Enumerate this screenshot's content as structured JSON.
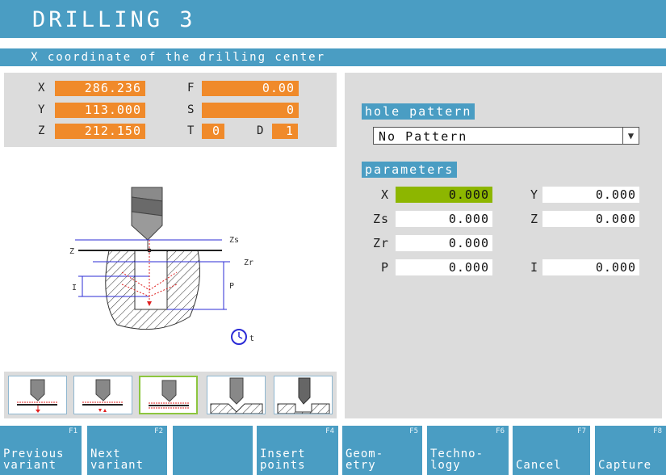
{
  "title": "DRILLING 3",
  "status_text": "X coordinate of the drilling center",
  "coords": {
    "x_label": "X",
    "x_value": "286.236",
    "y_label": "Y",
    "y_value": "113.000",
    "z_label": "Z",
    "z_value": "212.150",
    "f_label": "F",
    "f_value": "0.00",
    "s_label": "S",
    "s_value": "0",
    "t_label": "T",
    "t_value": "0",
    "d_label": "D",
    "d_value": "1"
  },
  "diagram": {
    "zs": "Zs",
    "z": "Z",
    "zr": "Zr",
    "p": "P",
    "i": "I",
    "t": "t"
  },
  "hole_pattern": {
    "heading": "hole pattern",
    "selected": "No Pattern"
  },
  "parameters": {
    "heading": "parameters",
    "x_label": "X",
    "x_value": "0.000",
    "y_label": "Y",
    "y_value": "0.000",
    "zs_label": "Zs",
    "zs_value": "0.000",
    "z_label": "Z",
    "z_value": "0.000",
    "zr_label": "Zr",
    "zr_value": "0.000",
    "p_label": "P",
    "p_value": "0.000",
    "i_label": "I",
    "i_value": "0.000"
  },
  "softkeys": [
    {
      "fn": "F1",
      "label": "Previous\nvariant"
    },
    {
      "fn": "F2",
      "label": "Next\nvariant"
    },
    {
      "fn": "",
      "label": ""
    },
    {
      "fn": "F4",
      "label": "Insert\npoints"
    },
    {
      "fn": "F5",
      "label": "Geom-\netry"
    },
    {
      "fn": "F6",
      "label": "Techno-\nlogy"
    },
    {
      "fn": "F7",
      "label": "Cancel"
    },
    {
      "fn": "F8",
      "label": "Capture"
    }
  ],
  "colors": {
    "accent": "#4a9dc3",
    "value_orange": "#f08a2a",
    "active_green": "#8db600"
  }
}
